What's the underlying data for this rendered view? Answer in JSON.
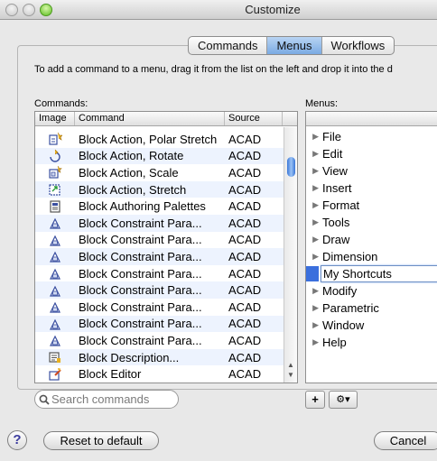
{
  "window": {
    "title": "Customize"
  },
  "tabs": [
    {
      "label": "Commands",
      "active": false
    },
    {
      "label": "Menus",
      "active": true
    },
    {
      "label": "Workflows",
      "active": false
    }
  ],
  "instructions": "To add a command to a menu, drag it from the list on the left and drop it into the d",
  "commands_panel": {
    "label": "Commands:",
    "columns": [
      "Image",
      "Command",
      "Source"
    ],
    "rows": [
      {
        "icon": "polar-stretch-icon",
        "command": "Block Action, Polar Stretch",
        "source": "ACAD"
      },
      {
        "icon": "rotate-icon",
        "command": "Block Action, Rotate",
        "source": "ACAD"
      },
      {
        "icon": "scale-icon",
        "command": "Block Action, Scale",
        "source": "ACAD"
      },
      {
        "icon": "stretch-icon",
        "command": "Block Action, Stretch",
        "source": "ACAD"
      },
      {
        "icon": "palettes-icon",
        "command": "Block Authoring Palettes",
        "source": "ACAD"
      },
      {
        "icon": "constraint-icon",
        "command": "Block Constraint Para...",
        "source": "ACAD"
      },
      {
        "icon": "constraint-icon",
        "command": "Block Constraint Para...",
        "source": "ACAD"
      },
      {
        "icon": "constraint-icon",
        "command": "Block Constraint Para...",
        "source": "ACAD"
      },
      {
        "icon": "constraint-icon",
        "command": "Block Constraint Para...",
        "source": "ACAD"
      },
      {
        "icon": "constraint-icon",
        "command": "Block Constraint Para...",
        "source": "ACAD"
      },
      {
        "icon": "constraint-icon",
        "command": "Block Constraint Para...",
        "source": "ACAD"
      },
      {
        "icon": "constraint-icon",
        "command": "Block Constraint Para...",
        "source": "ACAD"
      },
      {
        "icon": "constraint-icon",
        "command": "Block Constraint Para...",
        "source": "ACAD"
      },
      {
        "icon": "description-icon",
        "command": "Block Description...",
        "source": "ACAD"
      },
      {
        "icon": "editor-icon",
        "command": "Block Editor",
        "source": "ACAD"
      }
    ]
  },
  "menus_panel": {
    "label": "Menus:",
    "items": [
      "File",
      "Edit",
      "View",
      "Insert",
      "Format",
      "Tools",
      "Draw",
      "Dimension",
      "My Shortcuts",
      "Modify",
      "Parametric",
      "Window",
      "Help"
    ],
    "editing_item": "My Shortcuts"
  },
  "search": {
    "placeholder": "Search commands"
  },
  "buttons": {
    "add": "+",
    "gear": "⚙▾",
    "help": "?",
    "reset": "Reset to default",
    "cancel": "Cancel"
  },
  "colors": {
    "selection": "#3a6fdd",
    "active_tab": "#7aaae3"
  }
}
